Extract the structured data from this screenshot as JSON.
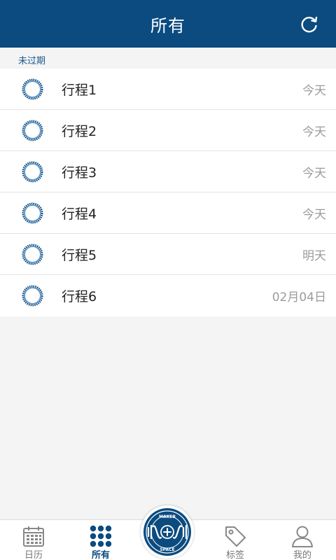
{
  "header": {
    "title": "所有",
    "refresh_icon": "refresh-icon"
  },
  "section": {
    "label": "未过期"
  },
  "items": [
    {
      "title": "行程1",
      "date": "今天"
    },
    {
      "title": "行程2",
      "date": "今天"
    },
    {
      "title": "行程3",
      "date": "今天"
    },
    {
      "title": "行程4",
      "date": "今天"
    },
    {
      "title": "行程5",
      "date": "明天"
    },
    {
      "title": "行程6",
      "date": "02月04日"
    }
  ],
  "tabbar": {
    "tabs": [
      {
        "label": "日历",
        "icon": "calendar-icon",
        "active": false
      },
      {
        "label": "所有",
        "icon": "grid-dots-icon",
        "active": true
      },
      {
        "label": "标签",
        "icon": "tag-icon",
        "active": false
      },
      {
        "label": "我的",
        "icon": "user-icon",
        "active": false
      }
    ],
    "center_button": {
      "icon": "add-logo-icon",
      "logo_top": "MAKER",
      "logo_bottom": "SPACE"
    }
  },
  "colors": {
    "primary": "#0b4b80",
    "background": "#f4f4f4",
    "date_text": "#9b9b9b",
    "section_text": "#1c5a8c"
  }
}
